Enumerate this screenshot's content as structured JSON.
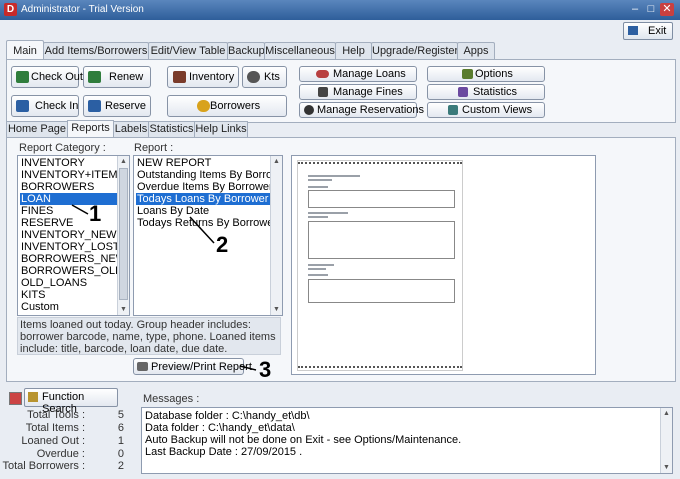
{
  "window": {
    "title": "Administrator - Trial Version",
    "icon_letter": "D"
  },
  "exit_label": "Exit",
  "main_tabs": [
    "Main",
    "Add Items/Borrowers",
    "Edit/View Table",
    "Backup",
    "Miscellaneous",
    "Help",
    "Upgrade/Register",
    "Apps"
  ],
  "toolbar": {
    "check_out": "Check Out",
    "renew": "Renew",
    "inventory": "Inventory",
    "kits": "Kts",
    "check_in": "Check In",
    "reserve": "Reserve",
    "borrowers": "Borrowers",
    "manage_loans": "Manage Loans",
    "manage_fines": "Manage Fines",
    "manage_reservations": "Manage Reservations",
    "options": "Options",
    "statistics": "Statistics",
    "custom_views": "Custom Views"
  },
  "sub_tabs": [
    "Home Page",
    "Reports",
    "Labels",
    "Statistics",
    "Help Links"
  ],
  "report_category_label": "Report Category :",
  "report_label": "Report :",
  "categories": [
    "INVENTORY",
    "INVENTORY+ITEMS",
    "BORROWERS",
    "LOAN",
    "FINES",
    "RESERVE",
    "INVENTORY_NEW",
    "INVENTORY_LOST",
    "BORROWERS_NEW",
    "BORROWERS_OLD",
    "OLD_LOANS",
    "KITS",
    "Custom"
  ],
  "selected_category": "LOAN",
  "reports": [
    "NEW REPORT",
    "Outstanding Items By Borrower",
    "Overdue Items By Borrower",
    "Todays Loans By Borrower",
    "Loans By Date",
    "Todays Returns By Borrower"
  ],
  "selected_report": "Todays Loans By Borrower",
  "description": "Items loaned out today. Group header includes: borrower barcode, name, type, phone. Loaned items include: title, barcode, loan date, due date.",
  "preview_button": "Preview/Print Report",
  "annotations": {
    "one": "1",
    "two": "2",
    "three": "3"
  },
  "function_search": "Function Search",
  "messages_label": "Messages :",
  "stats": [
    {
      "label": "Total Tools :",
      "value": "5"
    },
    {
      "label": "Total Items :",
      "value": "6"
    },
    {
      "label": "Loaned Out :",
      "value": "1"
    },
    {
      "label": "Overdue :",
      "value": "0"
    },
    {
      "label": "Total Borrowers :",
      "value": "2"
    }
  ],
  "messages": [
    "Database folder : C:\\handy_et\\db\\",
    "Data folder : C:\\handy_et\\data\\",
    "Auto Backup will not be done on Exit - see Options/Maintenance.",
    "Last Backup Date : 27/09/2015 ."
  ],
  "colors": {
    "selection": "#1e6ed2",
    "titlebar": "#2e5e9a",
    "close": "#c94040"
  }
}
